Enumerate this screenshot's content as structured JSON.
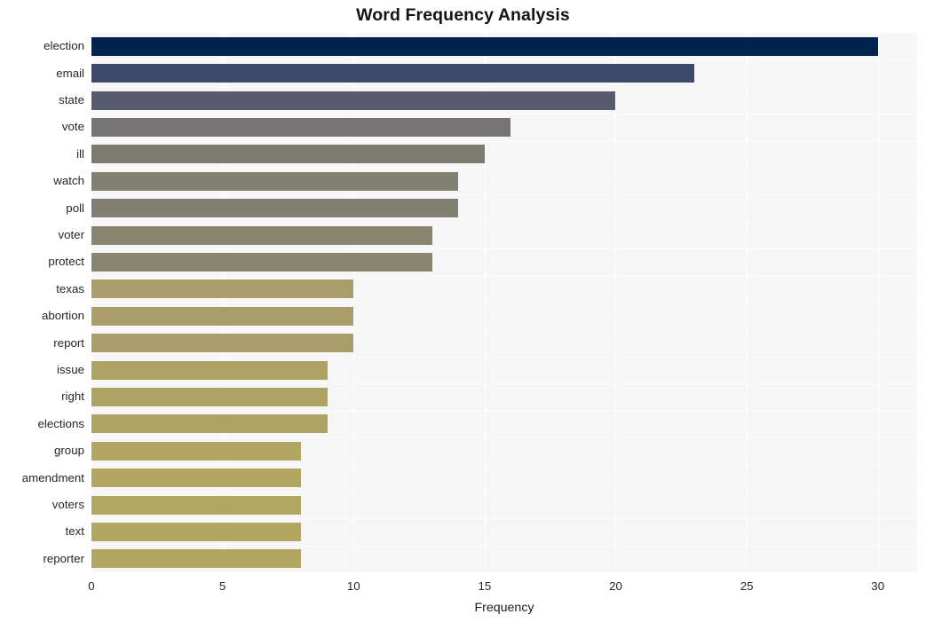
{
  "chart_data": {
    "type": "bar",
    "orientation": "horizontal",
    "title": "Word Frequency Analysis",
    "xlabel": "Frequency",
    "ylabel": "",
    "categories": [
      "election",
      "email",
      "state",
      "vote",
      "ill",
      "watch",
      "poll",
      "voter",
      "protect",
      "texas",
      "abortion",
      "report",
      "issue",
      "right",
      "elections",
      "group",
      "amendment",
      "voters",
      "text",
      "reporter"
    ],
    "values": [
      30,
      23,
      20,
      16,
      15,
      14,
      14,
      13,
      13,
      10,
      10,
      10,
      9,
      9,
      9,
      8,
      8,
      8,
      8,
      8
    ],
    "bar_colors": [
      "#00224e",
      "#3f4a6b",
      "#575c6f",
      "#757374",
      "#7d7a72",
      "#827f73",
      "#827f73",
      "#8a856f",
      "#8a856f",
      "#a99d6b",
      "#a99d6b",
      "#a99d6b",
      "#ada463",
      "#ada463",
      "#ada463",
      "#b3a562",
      "#b3a562",
      "#b3a562",
      "#b3a562",
      "#b3a562"
    ],
    "xlim": [
      0,
      31.5
    ],
    "xticks": [
      0,
      5,
      10,
      15,
      20,
      25,
      30
    ],
    "xtick_labels": [
      "0",
      "5",
      "10",
      "15",
      "20",
      "25",
      "30"
    ],
    "grid": true,
    "grid_axis": "both",
    "grid_color": "#ffffff",
    "plot_background": "#f6f6f6",
    "figure_background": "#ffffff",
    "legend": null,
    "colormap": "cividis"
  }
}
